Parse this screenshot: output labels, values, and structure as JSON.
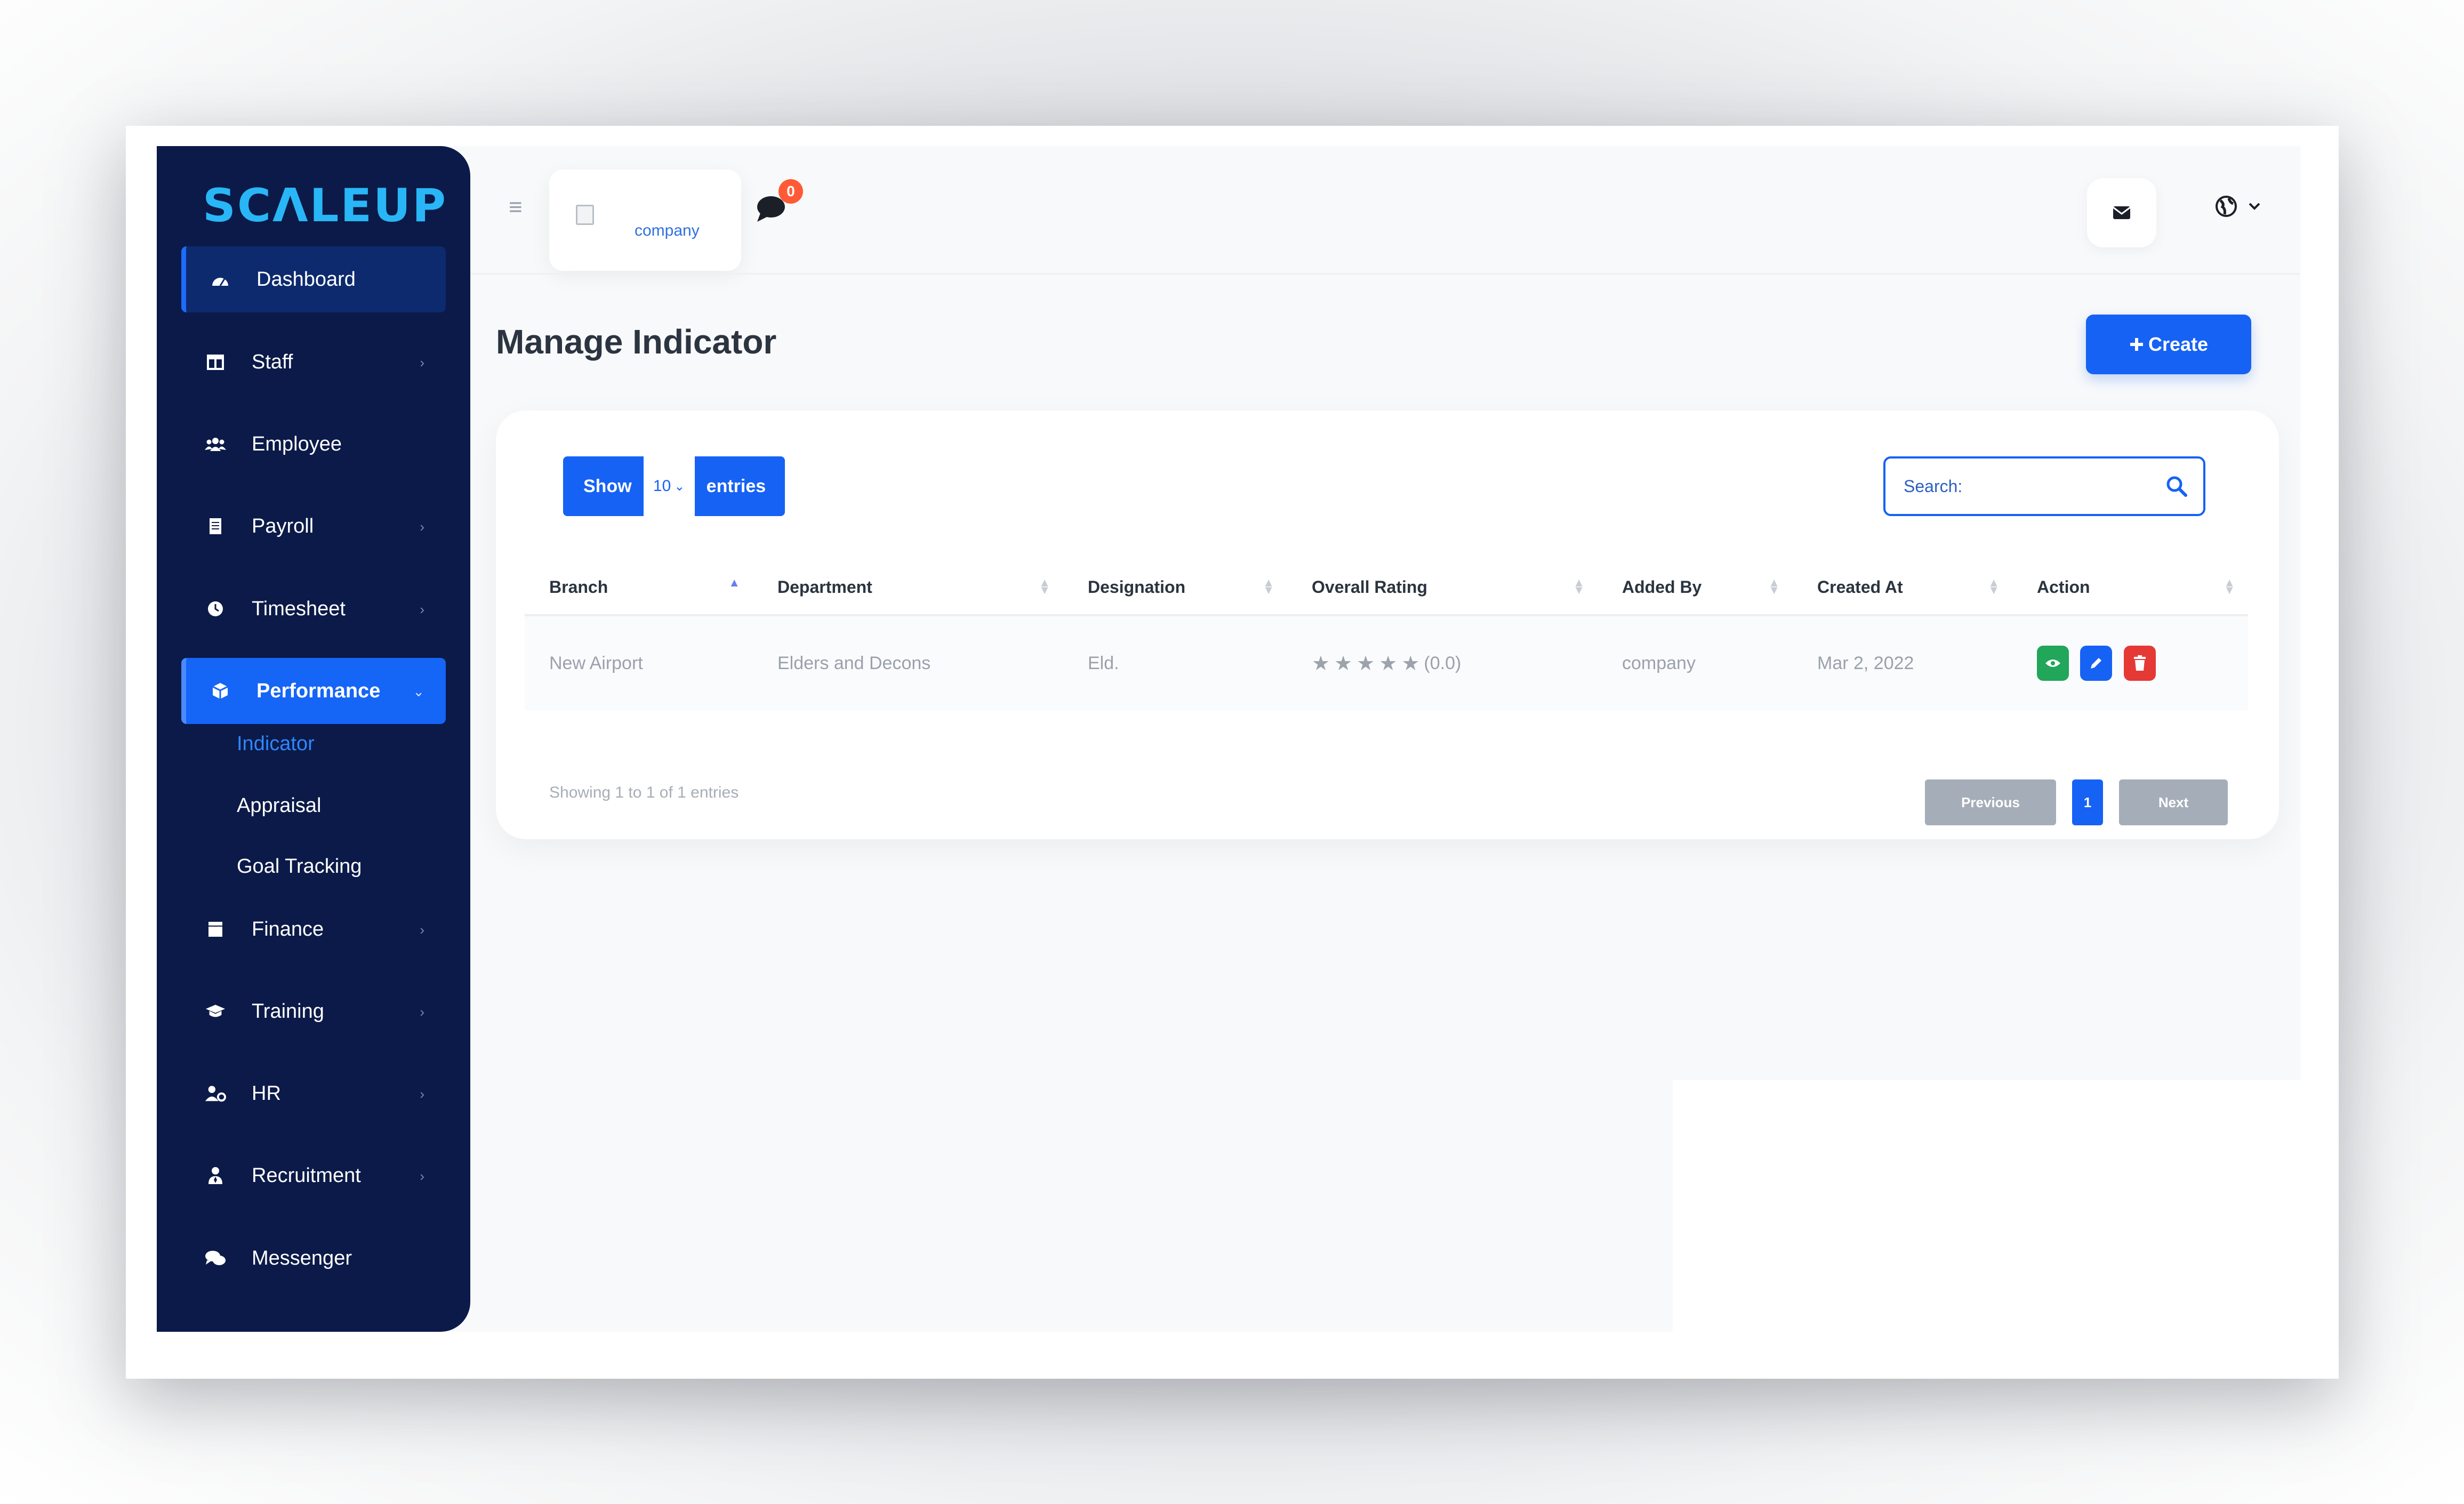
{
  "brand": {
    "logo_text": "SCΛLEUP"
  },
  "sidebar": {
    "items": [
      {
        "label": "Dashboard",
        "icon": "gauge-icon"
      },
      {
        "label": "Staff",
        "icon": "calendar-icon"
      },
      {
        "label": "Employee",
        "icon": "users-icon"
      },
      {
        "label": "Payroll",
        "icon": "receipt-icon"
      },
      {
        "label": "Timesheet",
        "icon": "clock-icon"
      },
      {
        "label": "Performance",
        "icon": "cube-icon"
      },
      {
        "label": "Finance",
        "icon": "wallet-icon"
      },
      {
        "label": "Training",
        "icon": "graduation-cap-icon"
      },
      {
        "label": "HR",
        "icon": "user-gear-icon"
      },
      {
        "label": "Recruitment",
        "icon": "user-tie-icon"
      },
      {
        "label": "Messenger",
        "icon": "comments-icon"
      }
    ],
    "performance_sub": [
      "Indicator",
      "Appraisal",
      "Goal Tracking"
    ]
  },
  "header": {
    "company_label": "company",
    "chat_badge": "0"
  },
  "page": {
    "title": "Manage Indicator",
    "create_label": "Create"
  },
  "table_controls": {
    "show_label": "Show",
    "entries_value": "10",
    "entries_label": "entries",
    "search_placeholder": "Search:"
  },
  "table": {
    "columns": [
      "Branch",
      "Department",
      "Designation",
      "Overall Rating",
      "Added By",
      "Created At",
      "Action"
    ],
    "rows": [
      {
        "branch": "New Airport",
        "department": "Elders and Decons",
        "designation": "Eld.",
        "rating": "(0.0)",
        "stars": 0,
        "added_by": "company",
        "created_at": "Mar 2, 2022"
      }
    ]
  },
  "footer": {
    "showing": "Showing 1 to 1 of 1 entries",
    "prev": "Previous",
    "page": "1",
    "next": "Next"
  },
  "colors": {
    "sidebar": "#0b1a48",
    "primary": "#1662f4",
    "view": "#21a65a",
    "delete": "#e53935"
  }
}
